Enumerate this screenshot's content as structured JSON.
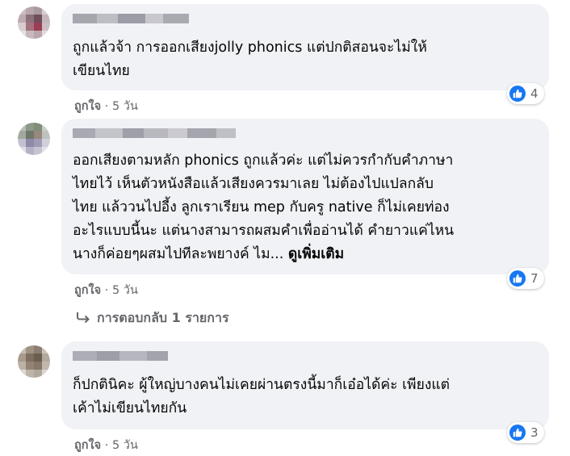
{
  "comments": [
    {
      "lines": [
        "ถูกแล้วจ้า การออกเสียงjolly phonics แต่ปกติสอนจะไม่ให้",
        "เขียนไทย"
      ],
      "reaction_count": "4",
      "like_label": "ถูกใจ",
      "separator": "·",
      "time": "5 วัน"
    },
    {
      "lines": [
        "ออกเสียงตามหลัก phonics ถูกแล้วค่ะ แต่ไม่ควรกำกับคำภาษา",
        "ไทยไว้ เห็นตัวหนังสือแล้วเสียงควรมาเลย ไม่ต้องไปแปลกลับ",
        "ไทย แล้ววนไปอี้ง ลูกเราเรียน mep กับครู native ก็ไม่เคยท่อง",
        "อะไรแบบนี้นะ แต่นางสามารถผสมคำเพื่ออ่านได้ คำยาวแค่ไหน",
        "นางก็ค่อยๆผสมไปทีละพยางค์ ไม..."
      ],
      "see_more": "ดูเพิ่มเติม",
      "reaction_count": "7",
      "like_label": "ถูกใจ",
      "separator": "·",
      "time": "5 วัน"
    },
    {
      "lines": [
        "ก็ปกตินิคะ ผู้ใหญ่บางคนไม่เคยผ่านตรงนี้มาก็เอ๋อได้ค่ะ เพียงแต่",
        "เค้าไม่เขียนไทยกัน"
      ],
      "reaction_count": "3",
      "like_label": "ถูกใจ",
      "separator": "·",
      "time": "5 วัน"
    }
  ],
  "replies_link": "การตอบกลับ 1 รายการ",
  "icons": {
    "reply_arrow": "reply-arrow-icon",
    "like": "thumbs-up-icon"
  },
  "colors": {
    "like_blue": "#1877f2",
    "bubble": "#f0f2f5",
    "meta": "#65676b"
  }
}
